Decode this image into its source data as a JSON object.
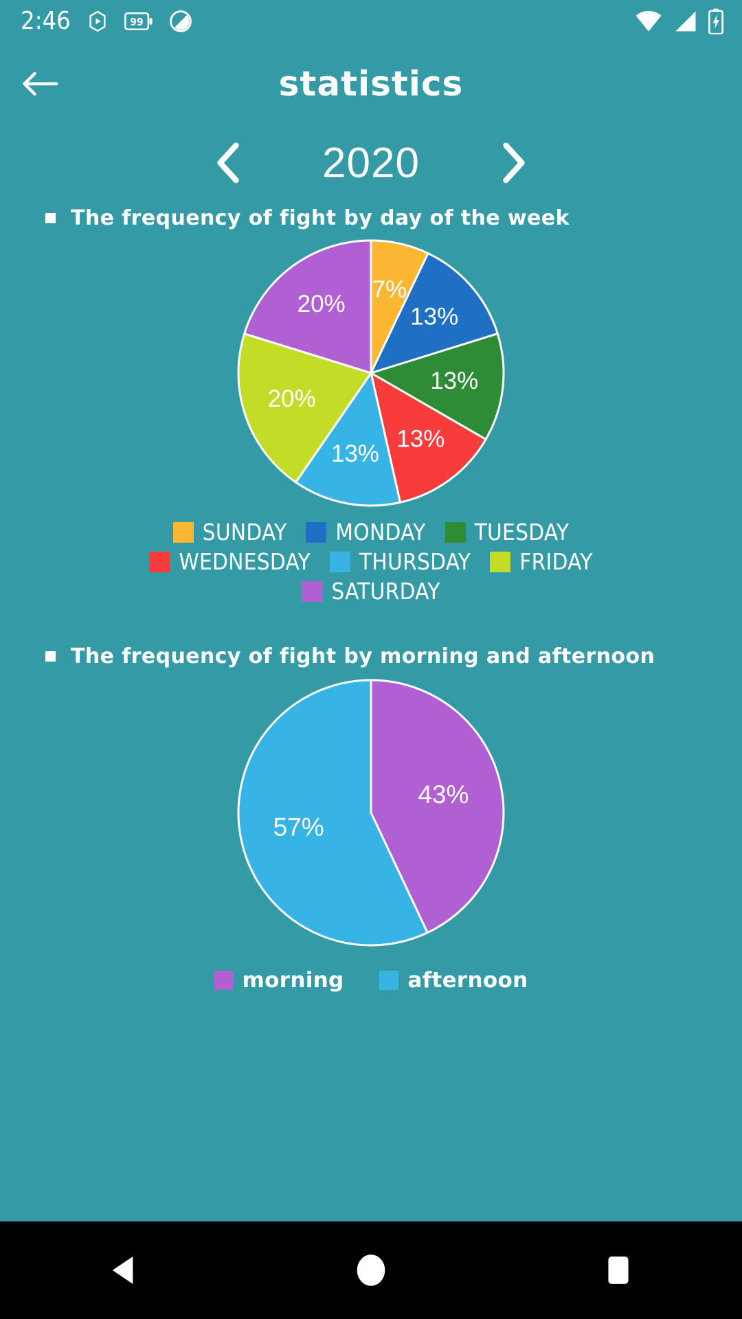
{
  "status_bar": {
    "time": "2:46",
    "icons_left": [
      "play-badge-icon",
      "battery-saver-99-icon",
      "do-not-disturb-icon"
    ],
    "icons_right": [
      "wifi-icon",
      "cellular-signal-icon",
      "battery-charging-icon"
    ],
    "battery_badge": "99"
  },
  "app_bar": {
    "back_icon": "back-arrow-icon",
    "title": "statistics"
  },
  "year_selector": {
    "prev_icon": "chevron-left-icon",
    "next_icon": "chevron-right-icon",
    "year": "2020"
  },
  "sections": [
    {
      "title": "The frequency of fight by day of the week"
    },
    {
      "title": "The frequency of fight by morning and afternoon"
    }
  ],
  "colors": {
    "background": "#339aa6",
    "nav_background": "#000000",
    "text": "#ffffff",
    "slice_divider": "#ffffff"
  },
  "chart_data": [
    {
      "type": "pie",
      "title": "The frequency of fight by day of the week",
      "legend_position": "bottom",
      "labels_format": "percent",
      "categories": [
        "SUNDAY",
        "MONDAY",
        "TUESDAY",
        "WEDNESDAY",
        "THURSDAY",
        "FRIDAY",
        "SATURDAY"
      ],
      "values": [
        7,
        13,
        13,
        13,
        13,
        20,
        20
      ],
      "display_labels": [
        "7%",
        "13%",
        "13%",
        "13%",
        "13%",
        "20%",
        "20%"
      ],
      "colors": [
        "#fbb731",
        "#1f6fc4",
        "#2e8b36",
        "#f83b3b",
        "#37b3e6",
        "#c2dc28",
        "#b160d4"
      ],
      "start_angle_deg": 0,
      "direction": "clockwise"
    },
    {
      "type": "pie",
      "title": "The frequency of fight by morning and afternoon",
      "legend_position": "bottom",
      "labels_format": "percent",
      "categories": [
        "morning",
        "afternoon"
      ],
      "values": [
        43,
        57
      ],
      "display_labels": [
        "43%",
        "57%"
      ],
      "colors": [
        "#b160d4",
        "#37b3e6"
      ],
      "start_angle_deg": 0,
      "direction": "clockwise"
    }
  ],
  "nav_bar": {
    "back_icon": "nav-back-triangle-icon",
    "home_icon": "nav-home-circle-icon",
    "recents_icon": "nav-recents-square-icon"
  }
}
